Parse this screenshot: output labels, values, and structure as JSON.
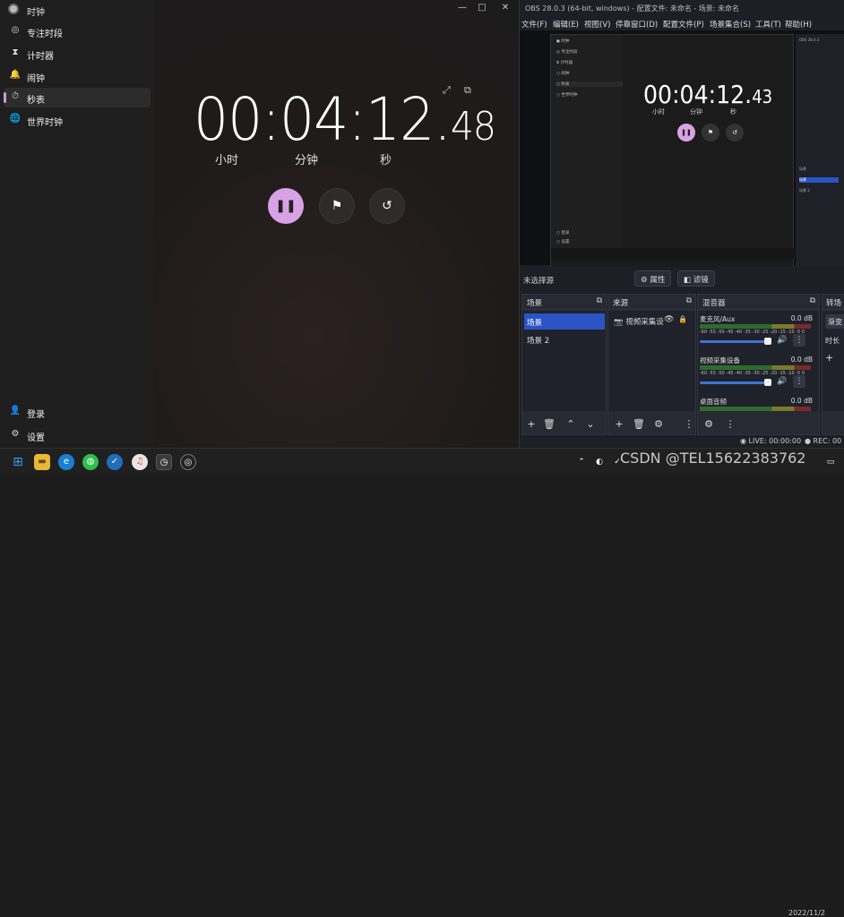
{
  "clock_app": {
    "title": "时钟",
    "nav": [
      {
        "label": "专注时段",
        "icon": "◎"
      },
      {
        "label": "计时器",
        "icon": "⧗"
      },
      {
        "label": "闹钟",
        "icon": "🔔"
      },
      {
        "label": "秒表",
        "icon": "⏱"
      },
      {
        "label": "世界时钟",
        "icon": "🌐"
      }
    ],
    "bottom_nav": [
      {
        "label": "登录",
        "icon": "👤"
      },
      {
        "label": "设置",
        "icon": "⚙"
      }
    ],
    "stopwatch": {
      "main": "00:04:12.",
      "centis": "48",
      "units": [
        "小时",
        "分钟",
        "秒"
      ]
    },
    "window_controls": {
      "min": "—",
      "max": "□",
      "close": "✕"
    }
  },
  "obs": {
    "title": "OBS 28.0.3 (64-bit, windows) - 配置文件: 未命名 - 场景: 未命名",
    "menu": [
      "文件(F)",
      "编辑(E)",
      "视图(V)",
      "停靠窗口(D)",
      "配置文件(P)",
      "场景集合(S)",
      "工具(T)",
      "帮助(H)"
    ],
    "preview": {
      "time_main": "00:04:12.",
      "time_cs": "43",
      "units": [
        "小时",
        "分钟",
        "秒"
      ]
    },
    "no_source": "未选择源",
    "tabs": {
      "properties": "属性",
      "filters": "滤镜"
    },
    "docks": {
      "scenes": "场景",
      "sources": "来源",
      "mixer": "混音器",
      "transitions": "转场"
    },
    "scenes": [
      "场景",
      "场景 2"
    ],
    "sources": [
      {
        "name": "视频采集设"
      }
    ],
    "mixer": [
      {
        "name": "麦克风/Aux",
        "db": "0.0 dB"
      },
      {
        "name": "视频采集设备",
        "db": "0.0 dB"
      },
      {
        "name": "桌面音频",
        "db": "0.0 dB"
      }
    ],
    "meter_scale": "-60 -55 -50 -45 -40 -35 -30 -25 -20 -15 -10 -5 0",
    "transition_partial": {
      "item": "渐变",
      "duration": "时长"
    },
    "status": {
      "live": "LIVE: 00:00:00",
      "rec": "REC: 00"
    }
  },
  "taskbar": {
    "watermark": "CSDN @TEL15622383762",
    "date": "2022/11/2"
  },
  "colors": {
    "accent": "#d9a2e6",
    "scene_select": "#2a54c5"
  }
}
